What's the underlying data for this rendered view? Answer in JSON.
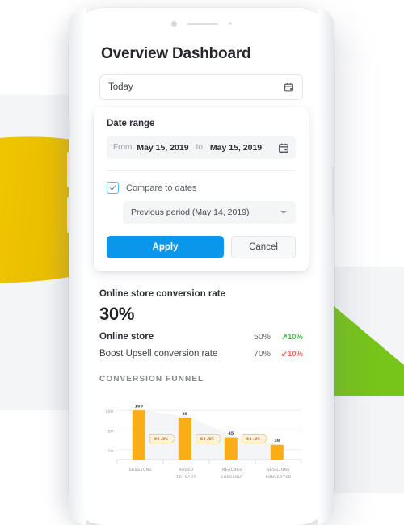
{
  "device": {
    "camera_icon": "camera-dot",
    "speaker_icon": "speaker-grill",
    "sensor_icon": "proximity-sensor-dot"
  },
  "header": {
    "title": "Overview Dashboard"
  },
  "range_select": {
    "value": "Today",
    "icon": "calendar-icon"
  },
  "dialog": {
    "heading": "Date range",
    "from_label": "From",
    "from_date": "May 15, 2019",
    "to_label": "to",
    "to_date": "May 15, 2019",
    "calendar_icon": "calendar-icon",
    "compare_label": "Compare to dates",
    "compare_checked": true,
    "period_value": "Previous period (May 14, 2019)",
    "caret_icon": "chevron-down-icon",
    "apply_label": "Apply",
    "cancel_label": "Cancel",
    "accent_color": "#0a96ea",
    "checkbox_border_color": "#5ab9f5"
  },
  "stats": {
    "title": "Online store conversion rate",
    "big_value": "30%",
    "rows": [
      {
        "name": "Online store",
        "value": "50%",
        "delta": "10%",
        "direction": "up",
        "arrow": "↗",
        "color": "#45c04a"
      },
      {
        "name": "Boost Upsell conversion rate",
        "value": "70%",
        "delta": "10%",
        "direction": "down",
        "arrow": "↙",
        "color": "#f4675f"
      }
    ]
  },
  "chart_data": {
    "type": "bar",
    "title": "CONVERSION FUNNEL",
    "categories": [
      "SESSIONS",
      "ADDED TO CART",
      "REACHED CHECKOUT",
      "SESSIONS CONVERTED"
    ],
    "category_lines": [
      [
        "SESSIONS"
      ],
      [
        "ADDED",
        "TO CART"
      ],
      [
        "REACHED",
        "CHECKOUT"
      ],
      [
        "SESSIONS",
        "CONVERTED"
      ]
    ],
    "values": [
      100,
      85,
      45,
      30
    ],
    "value_labels": [
      "100",
      "85",
      "45",
      "30"
    ],
    "step_labels": [
      "90.9%",
      "54.5%",
      "66.0%"
    ],
    "yticks": [
      20,
      60,
      100
    ],
    "ytick_labels": [
      "20",
      "60",
      "100"
    ],
    "ylim": [
      0,
      115
    ],
    "xlabel": "",
    "ylabel": "",
    "grid": true,
    "legend": "none",
    "bar_color": "#f9ad16",
    "badge_fill": "#fdf4e0",
    "badge_stroke": "#f6c14a",
    "badge_text_color": "#a07b25",
    "funnel_fill": "#f2f3f5"
  },
  "decor": {
    "yellow_shape": "#e8b800",
    "green_shape": "#77c41a",
    "card_color": "#f4f5f7"
  }
}
